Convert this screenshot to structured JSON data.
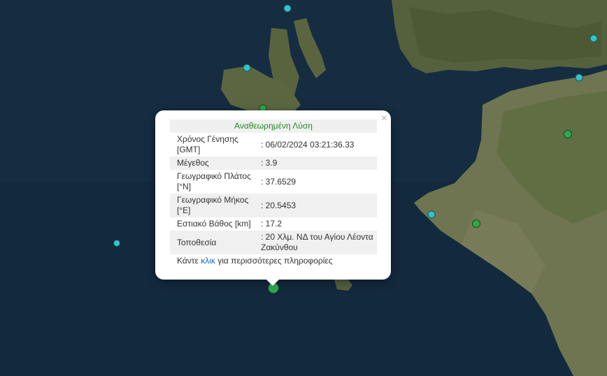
{
  "popup": {
    "close_label": "×",
    "title": "Αναθεωρημένη Λύση",
    "rows": [
      {
        "label": "Χρόνος Γένησης [GMT]",
        "value": ": 06/02/2024 03:21:36.33"
      },
      {
        "label": "Μέγεθος",
        "value": ": 3.9"
      },
      {
        "label": "Γεωγραφικό Πλάτος [°N]",
        "value": ": 37.6529"
      },
      {
        "label": "Γεωγραφικό Μήκος [°E]",
        "value": ": 20.5453"
      },
      {
        "label": "Εστιακό Βάθος [km]",
        "value": ": 17.2"
      },
      {
        "label": "Τοποθεσία",
        "value": ": 20 Χλμ. ΝΔ του Αγίου Λέοντα Ζακύνθου"
      }
    ],
    "more_prefix": "Κάντε ",
    "more_link": "κλικ",
    "more_suffix": " για περισσότερες πληροφορίες"
  },
  "colors": {
    "sea": "#13293d",
    "land": "#5f6a44",
    "quake_recent": "#2fa84f",
    "quake_older": "#33c3cf",
    "title_green": "#1e8a1e",
    "link_blue": "#1565c0"
  }
}
